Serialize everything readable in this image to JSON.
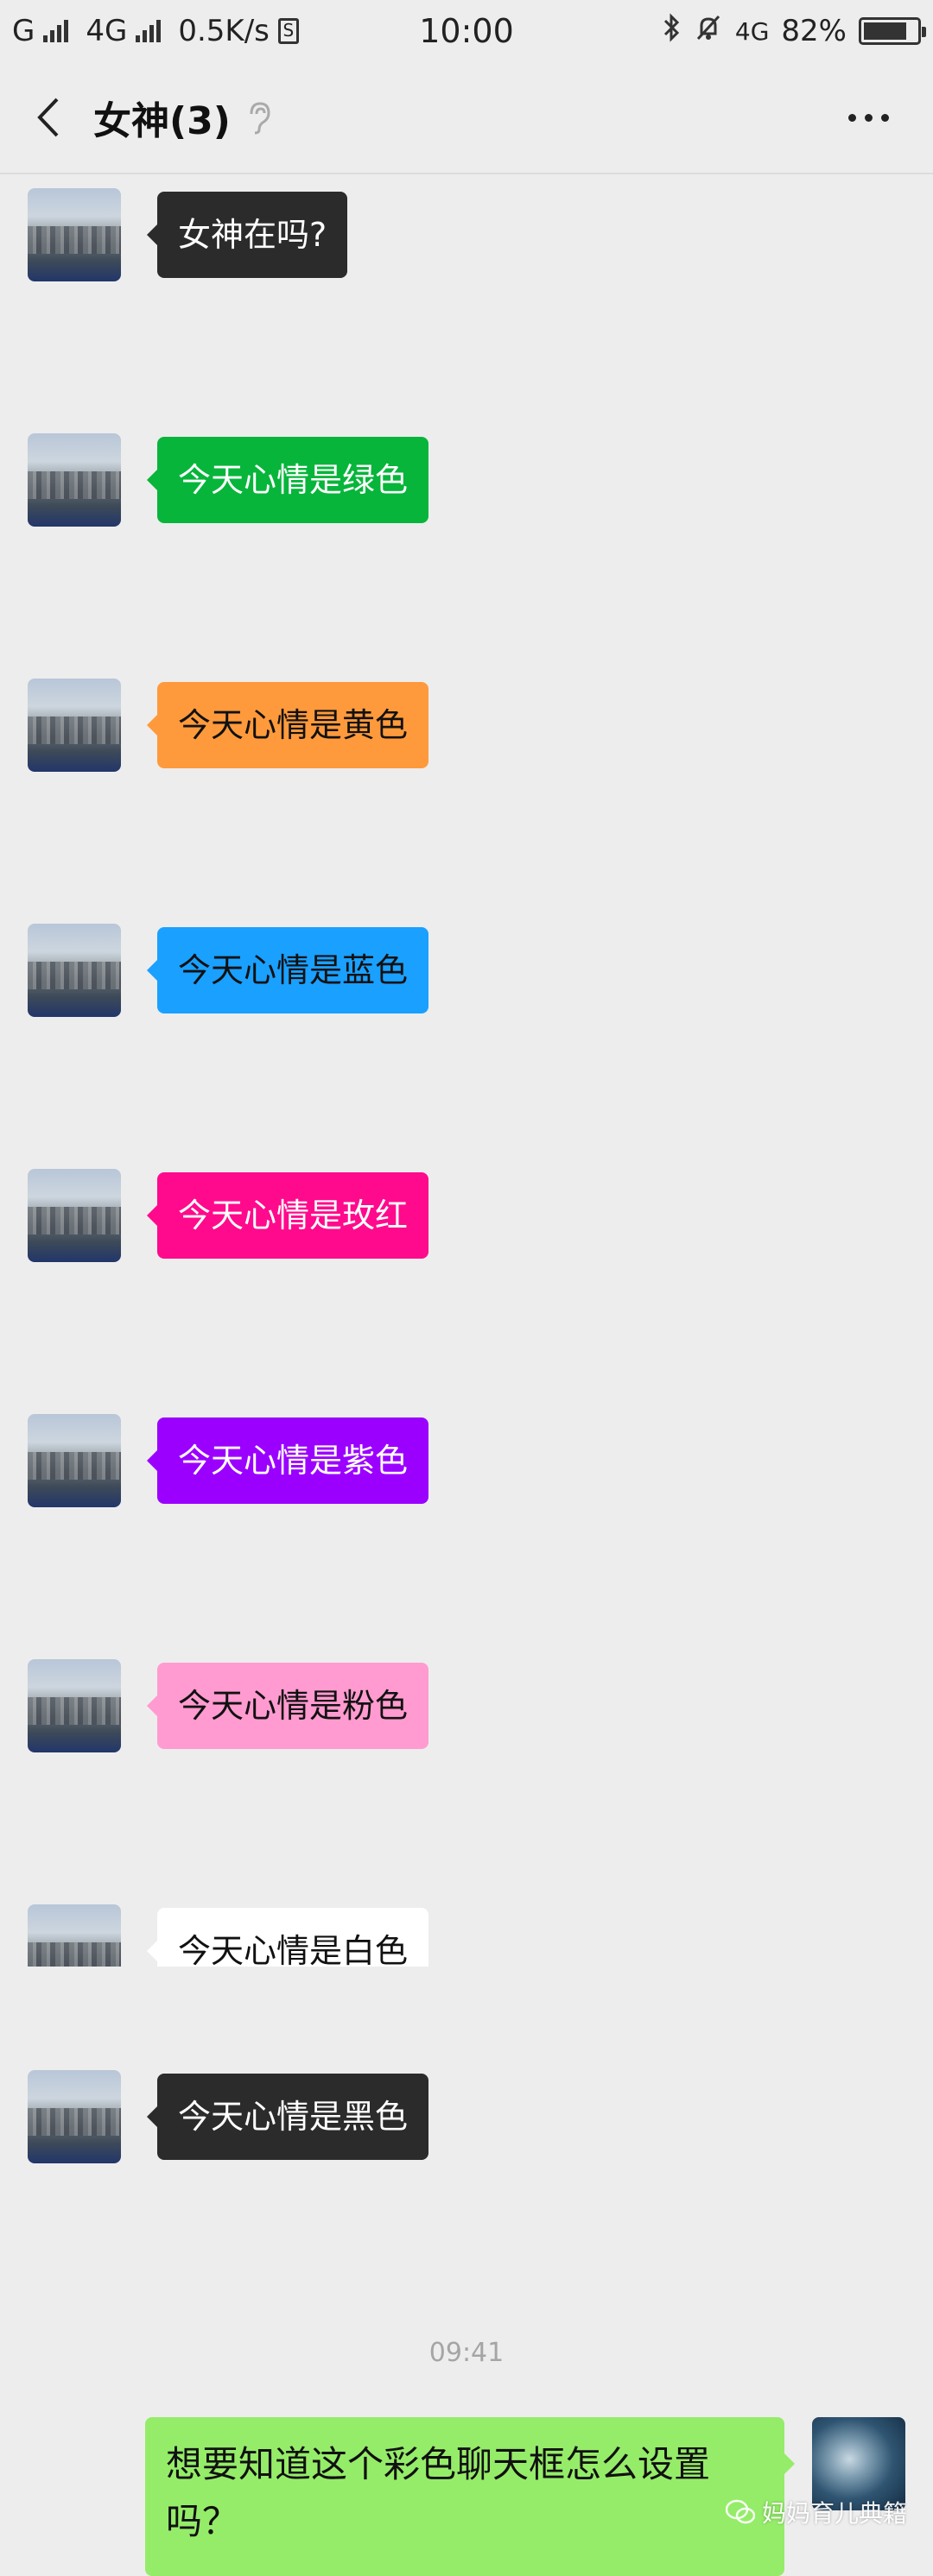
{
  "status_bar": {
    "carrier1": "G",
    "carrier2": "4G",
    "speed": "0.5K/s",
    "time": "10:00",
    "network": "4G",
    "battery": "82%",
    "battery_level": 0.82
  },
  "header": {
    "title": "女神(3)"
  },
  "messages": [
    {
      "text": "女神在吗?",
      "bg": "#2b2b2b",
      "color": "#ffffff"
    },
    {
      "text": "今天心情是绿色",
      "bg": "#07b53b",
      "color": "#ffffff"
    },
    {
      "text": "今天心情是黄色",
      "bg": "#ff9a3c",
      "color": "#111111"
    },
    {
      "text": "今天心情是蓝色",
      "bg": "#1aa0ff",
      "color": "#111111"
    },
    {
      "text": "今天心情是玫红",
      "bg": "#ff0a8c",
      "color": "#ffffff"
    },
    {
      "text": "今天心情是紫色",
      "bg": "#9b00ff",
      "color": "#ffffff"
    },
    {
      "text": "今天心情是粉色",
      "bg": "#ff9bd0",
      "color": "#111111"
    },
    {
      "text": "今天心情是白色",
      "bg": "#ffffff",
      "color": "#111111"
    },
    {
      "text": "今天心情是黑色",
      "bg": "#2b2b2b",
      "color": "#ffffff"
    }
  ],
  "timestamp": "09:41",
  "my_message": "想要知道这个彩色聊天框怎么设置吗？",
  "watermark": "妈妈育儿典籍"
}
